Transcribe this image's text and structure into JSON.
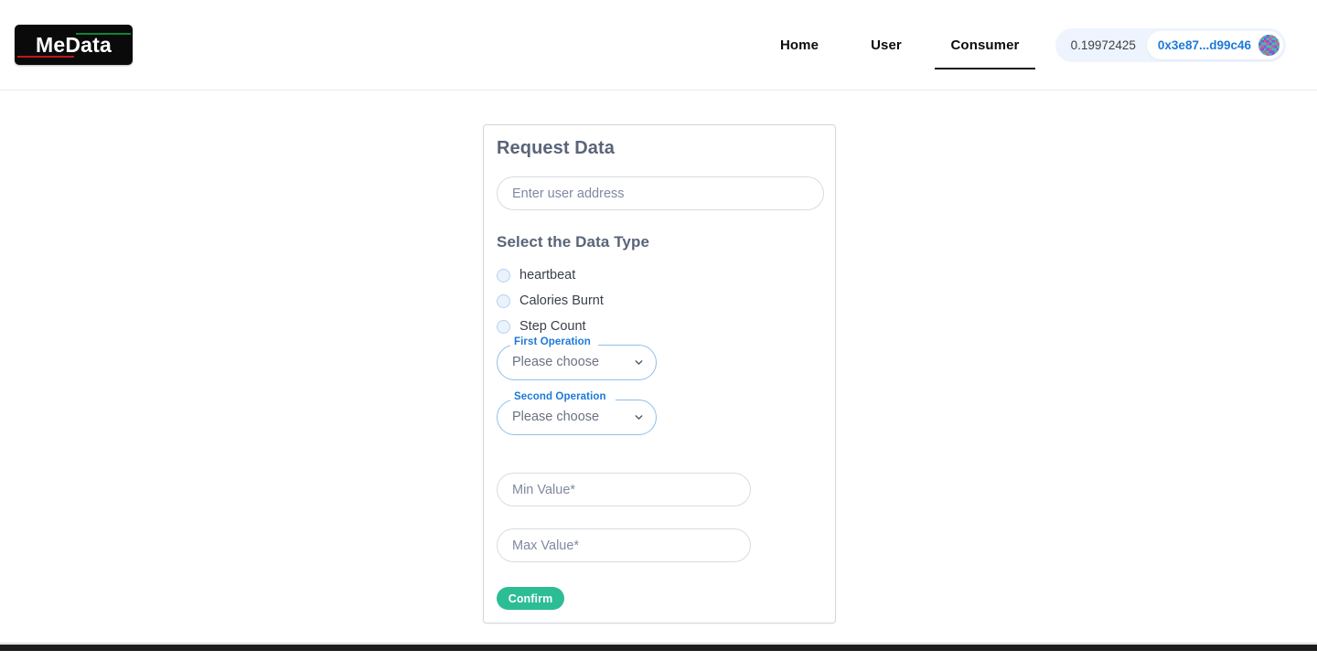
{
  "header": {
    "logo": {
      "text": "MeData",
      "accent_green": "#0a8537",
      "accent_red": "#c4161c",
      "background": "#0a0a0a"
    },
    "nav": [
      {
        "label": "Home",
        "active": false
      },
      {
        "label": "User",
        "active": false
      },
      {
        "label": "Consumer",
        "active": true
      }
    ],
    "wallet": {
      "balance": "0.19972425",
      "address": "0x3e87...d99c46",
      "address_color": "#1d79d8",
      "pill_background": "#eef4fd",
      "avatar_icon": "blockie-avatar-icon"
    }
  },
  "card": {
    "title": "Request Data",
    "address_input": {
      "placeholder": "Enter user address",
      "value": ""
    },
    "data_type": {
      "title": "Select the Data Type",
      "options": [
        {
          "label": "heartbeat",
          "selected": false
        },
        {
          "label": "Calories Burnt",
          "selected": false
        },
        {
          "label": "Step Count",
          "selected": false
        }
      ]
    },
    "first_operation": {
      "label": "First Operation",
      "value": "Please choose",
      "chevron_icon": "chevron-down-icon"
    },
    "second_operation": {
      "label": "Second Operation",
      "value": "Please choose",
      "chevron_icon": "chevron-down-icon"
    },
    "min_value_input": {
      "placeholder": "Min Value*",
      "value": ""
    },
    "max_value_input": {
      "placeholder": "Max Value*",
      "value": ""
    },
    "confirm_button": {
      "label": "Confirm",
      "color": "#2cbd95"
    }
  }
}
